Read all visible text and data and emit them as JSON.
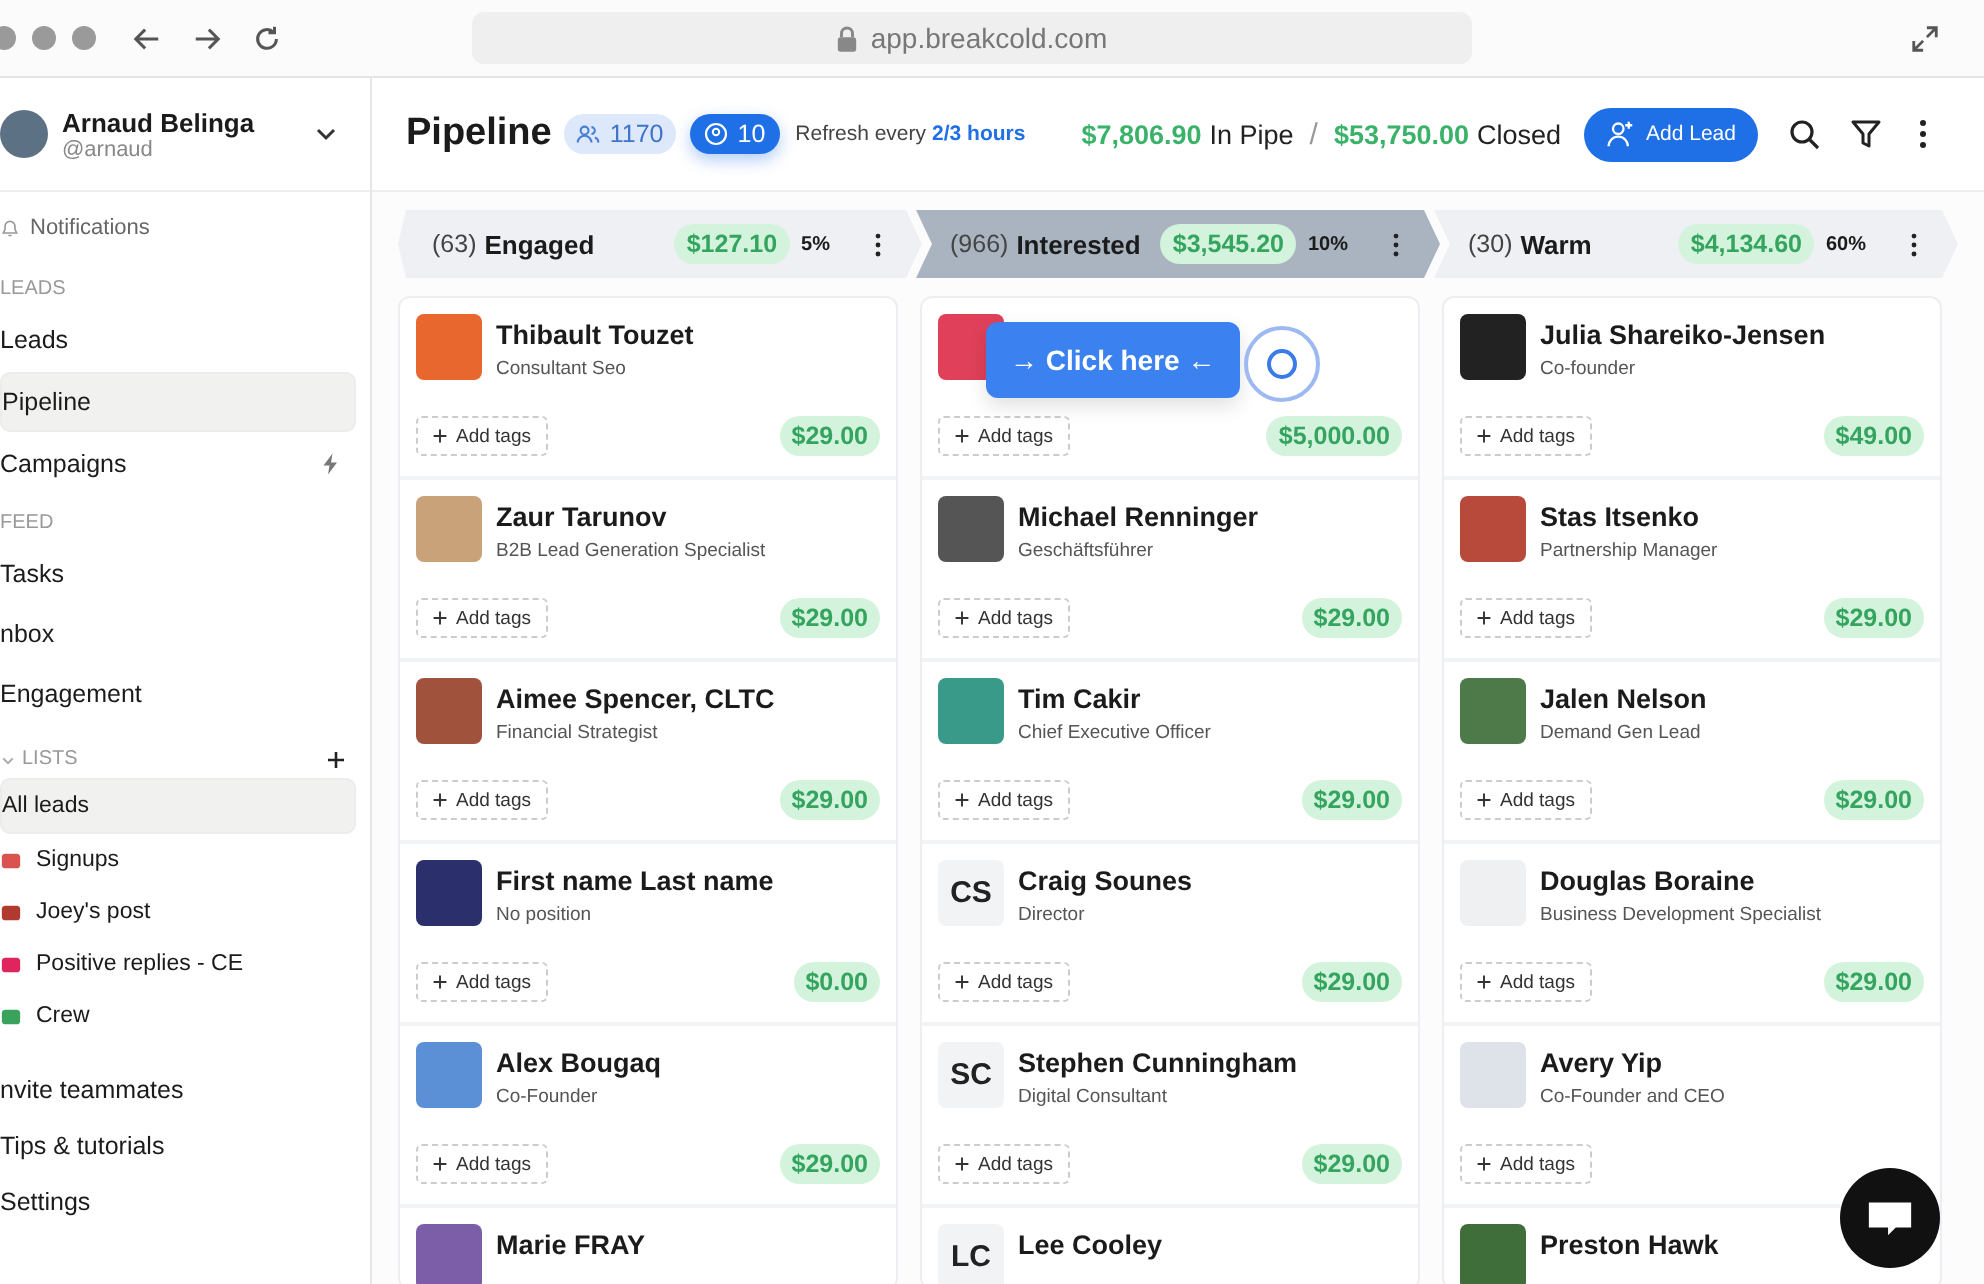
{
  "browser": {
    "url": "app.breakcold.com"
  },
  "sidebar": {
    "user": {
      "name": "Arnaud Belinga",
      "handle": "@arnaud"
    },
    "notifications": "Notifications",
    "sections": [
      {
        "title": "LEADS",
        "items": [
          {
            "label": "Leads",
            "selected": false,
            "kind": "plain"
          },
          {
            "label": "Pipeline",
            "selected": true,
            "kind": "plain"
          },
          {
            "label": "Campaigns",
            "selected": false,
            "kind": "bolt"
          }
        ]
      },
      {
        "title": "FEED",
        "items": [
          {
            "label": "Tasks",
            "selected": false,
            "kind": "plain"
          },
          {
            "label": "nbox",
            "selected": false,
            "kind": "plain"
          },
          {
            "label": "Engagement",
            "selected": false,
            "kind": "plain"
          }
        ]
      }
    ],
    "lists": {
      "title": "LISTS",
      "items": [
        {
          "label": "All leads",
          "selected": true
        },
        {
          "label": "Signups",
          "selected": false,
          "color": "#d9534f"
        },
        {
          "label": "Joey's post",
          "selected": false,
          "color": "#b03a2e"
        },
        {
          "label": "Positive replies - CE",
          "selected": false,
          "color": "#e0245e"
        },
        {
          "label": "Crew",
          "selected": false,
          "color": "#3aa35b"
        }
      ]
    },
    "footer": [
      "nvite teammates",
      "Tips & tutorials",
      "Settings"
    ]
  },
  "header": {
    "title": "Pipeline",
    "leads_count": "1170",
    "members_count": "10",
    "refresh_label": "Refresh every",
    "refresh_link": "2/3 hours",
    "in_pipe_amount": "$7,806.90",
    "in_pipe_label": "In Pipe",
    "separator": "/",
    "closed_amount": "$53,750.00",
    "closed_label": "Closed",
    "add_button": "Add Lead"
  },
  "stages": [
    {
      "count": "(63)",
      "name": "Engaged",
      "amount": "$127.10",
      "percent": "5%",
      "selected": false
    },
    {
      "count": "(966)",
      "name": "Interested",
      "amount": "$3,545.20",
      "percent": "10%",
      "selected": true
    },
    {
      "count": "(30)",
      "name": "Warm",
      "amount": "$4,134.60",
      "percent": "60%",
      "selected": false
    }
  ],
  "columns": [
    {
      "cards": [
        {
          "name": "Thibault Touzet",
          "title": "Consultant Seo",
          "tags_label": "Add tags",
          "amount": "$29.00",
          "kind": "photo",
          "color": "#e8672f"
        },
        {
          "name": "Zaur Tarunov",
          "title": "B2B Lead Generation Specialist",
          "tags_label": "Add tags",
          "amount": "$29.00",
          "kind": "photo",
          "color": "#c9a27a"
        },
        {
          "name": "Aimee Spencer, CLTC",
          "title": "Financial Strategist",
          "tags_label": "Add tags",
          "amount": "$29.00",
          "kind": "photo",
          "color": "#a0523d"
        },
        {
          "name": "First name Last name",
          "title": "No position",
          "tags_label": "Add tags",
          "amount": "$0.00",
          "kind": "photo",
          "color": "#2b2f6b"
        },
        {
          "name": "Alex Bougaq",
          "title": "Co-Founder",
          "tags_label": "Add tags",
          "amount": "$29.00",
          "kind": "photo",
          "color": "#5b8fd6"
        },
        {
          "name": "Marie FRAY",
          "kind": "photo",
          "color": "#7b5ea7"
        }
      ]
    },
    {
      "cards": [
        {
          "tags_label": "Add tags",
          "amount": "$5,000.00",
          "kind": "photo",
          "color": "#e0405a"
        },
        {
          "name": "Michael Renninger",
          "title": "Geschäftsführer",
          "tags_label": "Add tags",
          "amount": "$29.00",
          "kind": "photo",
          "color": "#555555"
        },
        {
          "name": "Tim Cakir",
          "title": "Chief Executive Officer",
          "tags_label": "Add tags",
          "amount": "$29.00",
          "kind": "photo",
          "color": "#3a9a8a"
        },
        {
          "name": "Craig Sounes",
          "title": "Director",
          "tags_label": "Add tags",
          "amount": "$29.00",
          "kind": "initials",
          "initials": "CS",
          "color": "#f1f3f5"
        },
        {
          "name": "Stephen Cunningham",
          "title": "Digital Consultant",
          "tags_label": "Add tags",
          "amount": "$29.00",
          "kind": "initials",
          "initials": "SC",
          "color": "#f1f3f5"
        },
        {
          "name": "Lee Cooley",
          "kind": "initials",
          "initials": "LC",
          "color": "#f1f3f5"
        }
      ]
    },
    {
      "cards": [
        {
          "name": "Julia Shareiko-Jensen",
          "title": "Co-founder",
          "tags_label": "Add tags",
          "amount": "$49.00",
          "kind": "photo",
          "color": "#222222"
        },
        {
          "name": "Stas Itsenko",
          "title": "Partnership Manager",
          "tags_label": "Add tags",
          "amount": "$29.00",
          "kind": "photo",
          "color": "#b84a3c"
        },
        {
          "name": "Jalen Nelson",
          "title": "Demand Gen Lead",
          "tags_label": "Add tags",
          "amount": "$29.00",
          "kind": "photo",
          "color": "#4e7a4a"
        },
        {
          "name": "Douglas Boraine",
          "title": "Business Development Specialist",
          "tags_label": "Add tags",
          "amount": "$29.00",
          "kind": "photo",
          "color": "#eef0f2"
        },
        {
          "name": "Avery Yip",
          "title": "Co-Founder and CEO",
          "tags_label": "Add tags",
          "kind": "photo",
          "color": "#dde3e8"
        },
        {
          "name": "Preston Hawk",
          "kind": "photo",
          "color": "#3f6e3a"
        }
      ]
    }
  ],
  "tooltip": {
    "text": "→ Click here ←"
  }
}
